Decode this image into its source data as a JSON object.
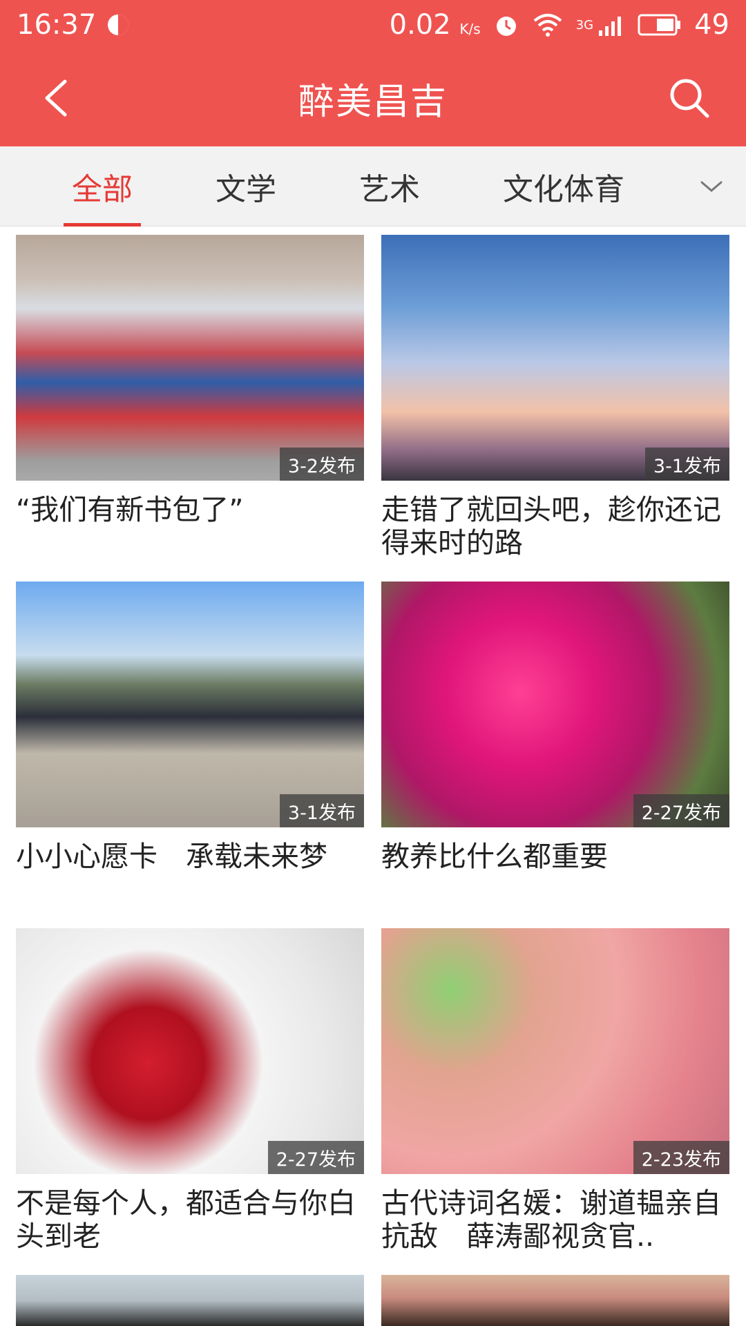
{
  "status_bar": {
    "time": "16:37",
    "speed": "0.02",
    "speed_unit": "K/s",
    "network": "3G",
    "battery": "49"
  },
  "header": {
    "title": "醉美昌吉",
    "back_icon": "back-arrow-icon",
    "search_icon": "search-icon"
  },
  "tabs": [
    {
      "label": "全部",
      "active": true
    },
    {
      "label": "文学",
      "active": false
    },
    {
      "label": "艺术",
      "active": false
    },
    {
      "label": "文化体育",
      "active": false
    }
  ],
  "accent_color": "#ef5350",
  "articles": [
    {
      "title": "“我们有新书包了”",
      "date": "3-2发布"
    },
    {
      "title": "走错了就回头吧，趁你还记得来时的路",
      "date": "3-1发布"
    },
    {
      "title": "小小心愿卡　承载未来梦",
      "date": "3-1发布"
    },
    {
      "title": "教养比什么都重要",
      "date": "2-27发布"
    },
    {
      "title": "不是每个人，都适合与你白头到老",
      "date": "2-27发布"
    },
    {
      "title": "古代诗词名媛：谢道韫亲自抗敌　薛涛鄙视贪官..",
      "date": "2-23发布"
    }
  ]
}
